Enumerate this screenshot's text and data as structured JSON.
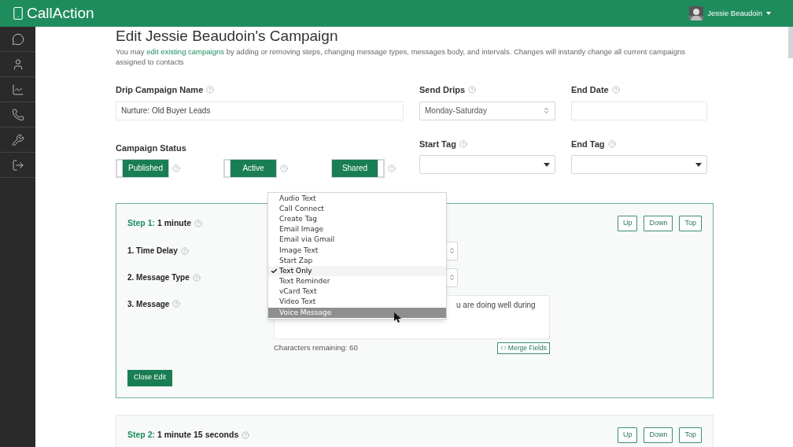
{
  "app": {
    "logo": "Call**Action**"
  },
  "user": {
    "name": "Jessie Beaudoin"
  },
  "sidebar": {
    "items": [
      {
        "kind": "chat"
      },
      {
        "kind": "contacts"
      },
      {
        "kind": "reports"
      },
      {
        "kind": "calls"
      },
      {
        "kind": "tools"
      },
      {
        "kind": "logout"
      }
    ]
  },
  "page": {
    "title": "Edit Jessie Beaudoin's Campaign",
    "intro_before": "You may",
    "intro_link": "edit existing campaigns",
    "intro_after": "by adding or removing steps, changing message types, messages body, and intervals. Changes will instantly change all current campaigns assigned to contacts"
  },
  "form": {
    "drip_name": {
      "label": "Drip Campaign Name",
      "value": "Nurture: Old Buyer Leads"
    },
    "send_drips": {
      "label": "Send Drips",
      "value": "Monday-Saturday"
    },
    "end_date": {
      "label": "End Date"
    },
    "campaign_status": {
      "label": "Campaign Status",
      "toggles": [
        {
          "label": "Published",
          "on": false
        },
        {
          "label": "Active",
          "on": false
        },
        {
          "label": "Shared",
          "on": true
        }
      ]
    },
    "start_tag": {
      "label": "Start Tag"
    },
    "end_tag": {
      "label": "End Tag"
    }
  },
  "steps": [
    {
      "prefix": "Step 1:",
      "interval": "1 minute",
      "expanded": true,
      "buttons": [
        "Up",
        "Down",
        "Top"
      ],
      "fields": [
        {
          "label": "1. Time Delay"
        },
        {
          "label": "2. Message Type"
        },
        {
          "label": "3. Message",
          "value": "u are doing well during"
        }
      ],
      "chars_remaining": "Characters remaining: 60",
      "merge_button": "Merge Fields",
      "close_button": "Close Edit"
    },
    {
      "prefix": "Step 2:",
      "interval": "1 minute 15 seconds",
      "expanded": false,
      "buttons": [
        "Up",
        "Down",
        "Top"
      ]
    }
  ],
  "dropdown": {
    "options": [
      {
        "label": "Audio Text",
        "selected": false,
        "hovered": false
      },
      {
        "label": "Call Connect",
        "selected": false,
        "hovered": false
      },
      {
        "label": "Create Tag",
        "selected": false,
        "hovered": false
      },
      {
        "label": "Email Image",
        "selected": false,
        "hovered": false
      },
      {
        "label": "Email via Gmail",
        "selected": false,
        "hovered": false
      },
      {
        "label": "Image Text",
        "selected": false,
        "hovered": false
      },
      {
        "label": "Start Zap",
        "selected": false,
        "hovered": false
      },
      {
        "label": "Text Only",
        "selected": true,
        "hovered": false
      },
      {
        "label": "Text Reminder",
        "selected": false,
        "hovered": false
      },
      {
        "label": "vCard Text",
        "selected": false,
        "hovered": false
      },
      {
        "label": "Video Text",
        "selected": false,
        "hovered": false
      },
      {
        "label": "Voice Message",
        "selected": false,
        "hovered": true
      }
    ]
  }
}
